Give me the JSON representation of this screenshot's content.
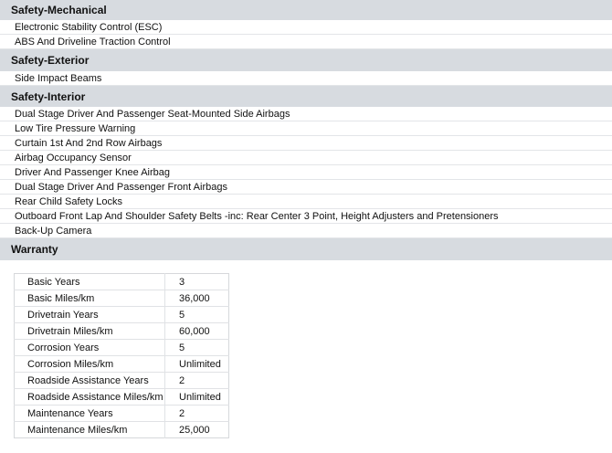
{
  "sections": [
    {
      "title": "Safety-Mechanical",
      "items": [
        "Electronic Stability Control (ESC)",
        "ABS And Driveline Traction Control"
      ]
    },
    {
      "title": "Safety-Exterior",
      "items": [
        "Side Impact Beams"
      ]
    },
    {
      "title": "Safety-Interior",
      "items": [
        "Dual Stage Driver And Passenger Seat-Mounted Side Airbags",
        "Low Tire Pressure Warning",
        "Curtain 1st And 2nd Row Airbags",
        "Airbag Occupancy Sensor",
        "Driver And Passenger Knee Airbag",
        "Dual Stage Driver And Passenger Front Airbags",
        "Rear Child Safety Locks",
        "Outboard Front Lap And Shoulder Safety Belts -inc: Rear Center 3 Point, Height Adjusters and Pretensioners",
        "Back-Up Camera"
      ]
    }
  ],
  "warranty": {
    "title": "Warranty",
    "rows": [
      {
        "label": "Basic Years",
        "value": "3"
      },
      {
        "label": "Basic Miles/km",
        "value": "36,000"
      },
      {
        "label": "Drivetrain Years",
        "value": "5"
      },
      {
        "label": "Drivetrain Miles/km",
        "value": "60,000"
      },
      {
        "label": "Corrosion Years",
        "value": "5"
      },
      {
        "label": "Corrosion Miles/km",
        "value": "Unlimited"
      },
      {
        "label": "Roadside Assistance Years",
        "value": "2"
      },
      {
        "label": "Roadside Assistance Miles/km",
        "value": "Unlimited"
      },
      {
        "label": "Maintenance Years",
        "value": "2"
      },
      {
        "label": "Maintenance Miles/km",
        "value": "25,000"
      }
    ]
  }
}
